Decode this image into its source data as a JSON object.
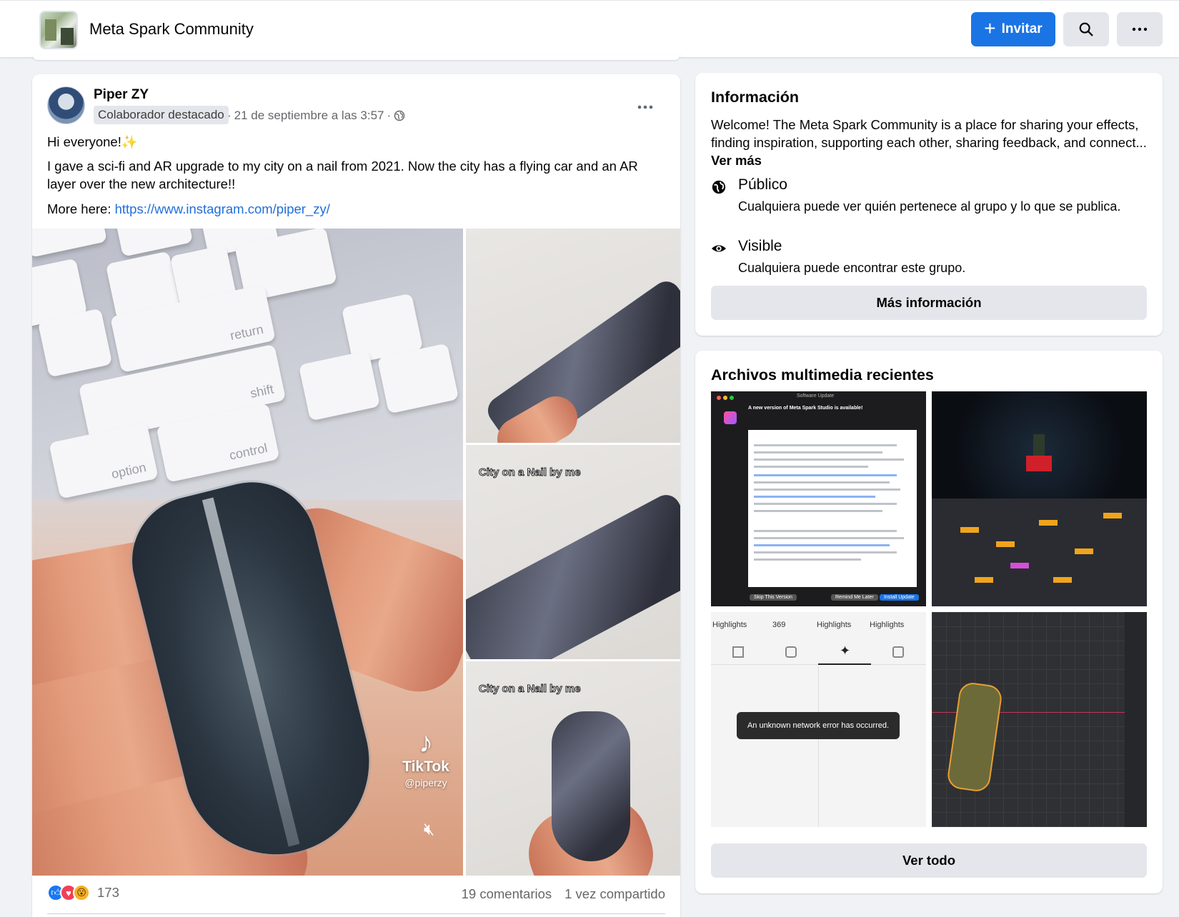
{
  "header": {
    "group_name": "Meta Spark Community",
    "invite_label": "Invitar",
    "search_icon": "search-icon",
    "more_icon": "more-horizontal-icon"
  },
  "post": {
    "author": "Piper ZY",
    "badge": "Colaborador destacado",
    "timestamp": "21 de septiembre a las 3:57",
    "separator": "·",
    "privacy_icon": "globe-icon",
    "greeting": "Hi everyone!",
    "greeting_emoji": "✨",
    "body": "I gave a sci-fi and AR upgrade to my city on a nail from 2021. Now the city has a flying car and an AR layer over the new architecture!!",
    "more_prefix": "More here: ",
    "link": "https://www.instagram.com/piper_zy/",
    "media": {
      "keys": [
        "return",
        "shift",
        "option",
        "control"
      ],
      "tiktok_label": "TikTok",
      "tiktok_user": "@piperzy",
      "caption": "City on a Nail by me"
    },
    "reaction_count": "173",
    "comments": "19 comentarios",
    "shares": "1 vez compartido"
  },
  "info": {
    "title": "Información",
    "description": "Welcome! The Meta Spark Community is a place for sharing your effects, finding inspiration, supporting each other, sharing feedback, and connect...",
    "see_more": "Ver más",
    "public_title": "Público",
    "public_desc": "Cualquiera puede ver quién pertenece al grupo y lo que se publica.",
    "visible_title": "Visible",
    "visible_desc": "Cualquiera puede encontrar este grupo.",
    "more_info_button": "Más información"
  },
  "media_card": {
    "title": "Archivos multimedia recientes",
    "see_all_button": "Ver todo",
    "thumb1_title": "Software Update",
    "thumb1_heading": "A new version of Meta Spark Studio is available!",
    "thumb1_buttons": [
      "Skip This Version",
      "Remind Me Later",
      "Install Update"
    ],
    "thumb3_highlights": [
      "Highlights",
      "369",
      "Highlights",
      "Highlights"
    ],
    "thumb3_error": "An unknown network error has occurred."
  },
  "colors": {
    "accent": "#1b74e4",
    "link": "#216fdb",
    "background": "#f0f2f5",
    "secondary_text": "#65676b"
  }
}
